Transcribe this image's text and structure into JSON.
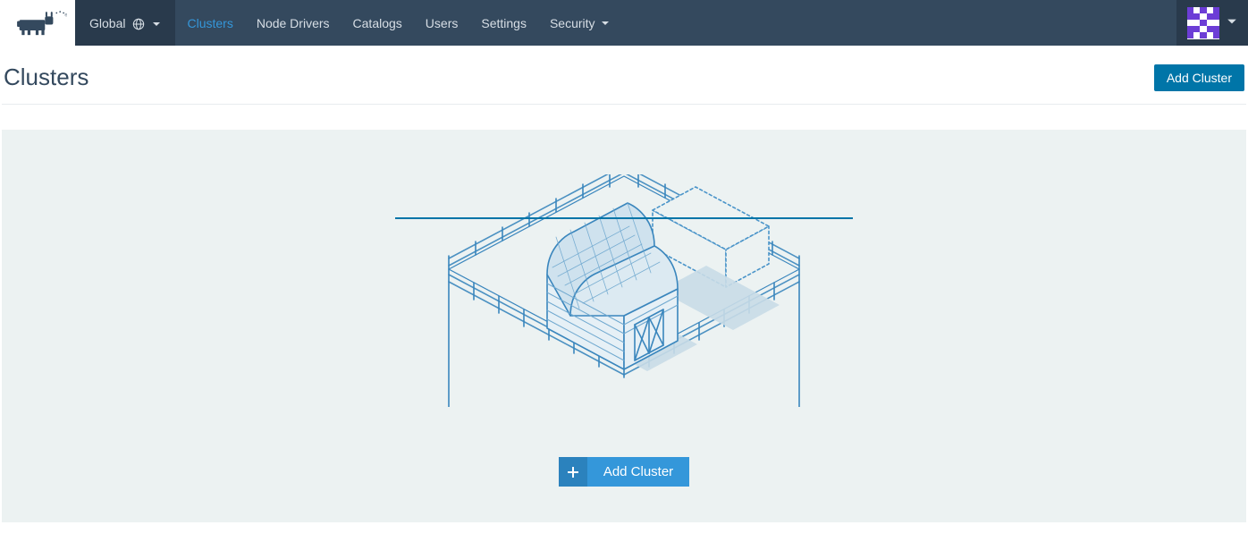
{
  "nav": {
    "global_label": "Global",
    "items": [
      {
        "label": "Clusters",
        "active": true
      },
      {
        "label": "Node Drivers"
      },
      {
        "label": "Catalogs"
      },
      {
        "label": "Users"
      },
      {
        "label": "Settings"
      },
      {
        "label": "Security",
        "dropdown": true
      }
    ]
  },
  "page": {
    "title": "Clusters",
    "add_cluster_label": "Add Cluster"
  },
  "empty": {
    "add_cluster_label": "Add Cluster"
  },
  "colors": {
    "topbar": "#34495e",
    "topbar_dark": "#293a4c",
    "accent": "#3497da",
    "primary_button": "#0075a8",
    "empty_bg": "#ecf2f2",
    "avatar": "#6c3dd6"
  }
}
